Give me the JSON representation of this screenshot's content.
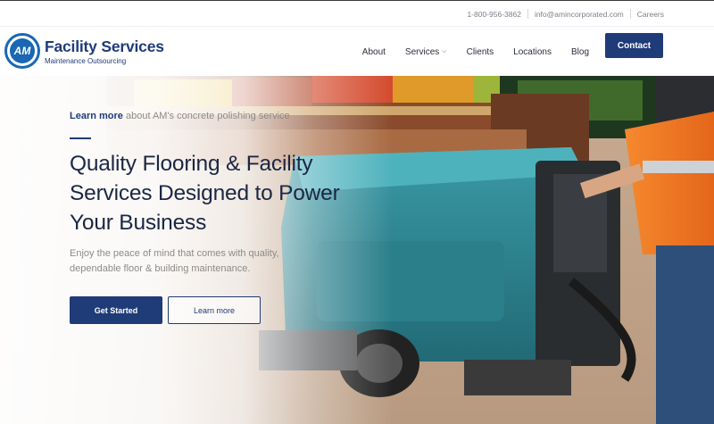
{
  "topbar": {
    "phone": "1-800-956-3862",
    "email": "info@amincorporated.com",
    "careers": "Careers"
  },
  "logo": {
    "badge": "AM",
    "title": "Facility Services",
    "tagline": "Maintenance Outsourcing"
  },
  "nav": {
    "items": [
      "About",
      "Services",
      "Clients",
      "Locations",
      "Blog"
    ],
    "contact_label": "Contact"
  },
  "hero": {
    "promo_link": "Learn more",
    "promo_text": " about AM's concrete polishing service",
    "headline": "Quality Flooring & Facility Services Designed to Power Your Business",
    "subcopy": "Enjoy the peace of mind that comes with quality, dependable floor & building maintenance.",
    "primary_button": "Get Started",
    "secondary_button": "Learn more"
  },
  "colors": {
    "brand_navy": "#1f3b78",
    "logo_blue": "#1a67b3",
    "machine_teal": "#2f8a96",
    "vest_orange": "#f07a24"
  }
}
